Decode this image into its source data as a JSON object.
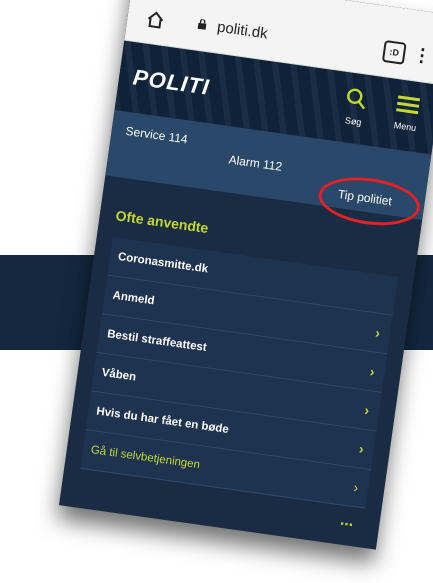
{
  "browser": {
    "url": "politi.dk"
  },
  "site": {
    "logo": "POLITI",
    "search_label": "Søg",
    "menu_label": "Menu"
  },
  "service": {
    "service_114": "Service 114",
    "alarm_112": "Alarm 112",
    "tip": "Tip politiet"
  },
  "section": {
    "title": "Ofte anvendte",
    "items": [
      {
        "label": "Coronasmitte.dk",
        "chevron": false
      },
      {
        "label": "Anmeld",
        "chevron": true
      },
      {
        "label": "Bestil straffeattest",
        "chevron": true
      },
      {
        "label": "Våben",
        "chevron": true
      },
      {
        "label": "Hvis du har fået en bøde",
        "chevron": true
      },
      {
        "label": "Gå til selvbetjeningen",
        "chevron": true
      }
    ],
    "more": "..."
  },
  "colors": {
    "accent": "#c4d82e",
    "circle": "#e32127",
    "navy": "#1a2c44"
  }
}
